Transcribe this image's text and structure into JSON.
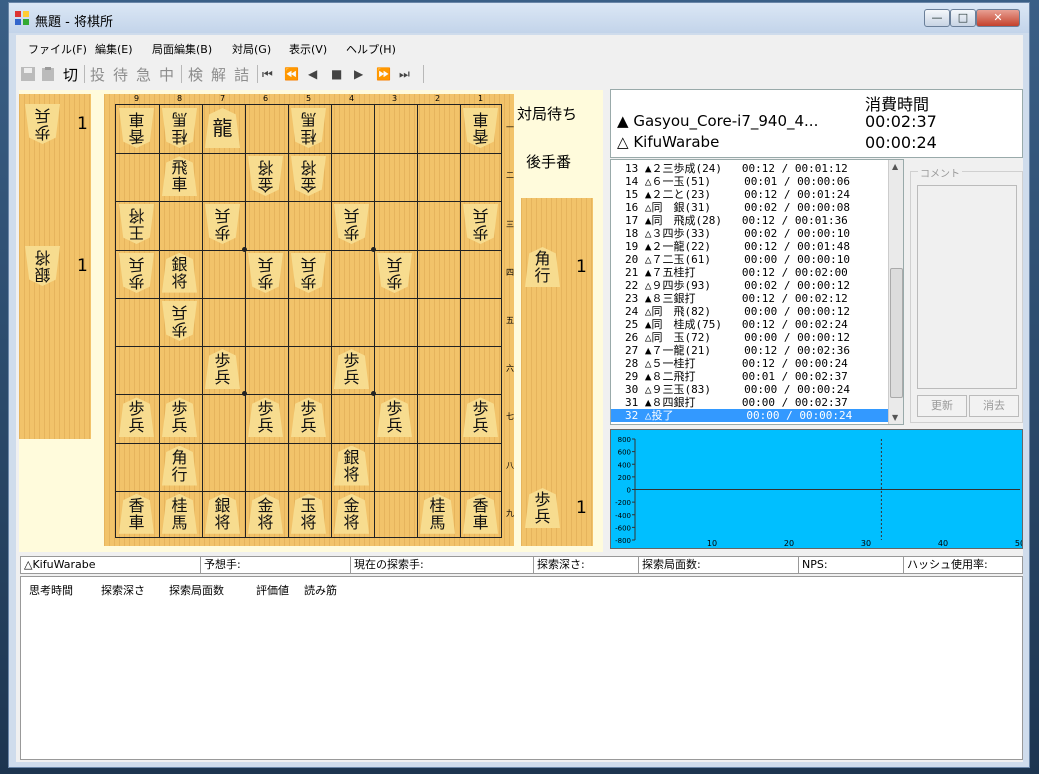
{
  "window": {
    "title": "無題 - 将棋所",
    "min": "—",
    "max": "□",
    "close": "✕"
  },
  "menu": [
    "ファイル(F)",
    "編集(E)",
    "局面編集(B)",
    "対局(G)",
    "表示(V)",
    "ヘルプ(H)"
  ],
  "toolbar": {
    "cut": "切",
    "kanji_buttons": [
      "投",
      "待",
      "急",
      "中",
      "検",
      "解",
      "詰"
    ],
    "nav_buttons": [
      "⏮",
      "⏪",
      "◀",
      "■",
      "▶",
      "⏩",
      "⏭"
    ]
  },
  "board": {
    "files": [
      "9",
      "8",
      "7",
      "6",
      "5",
      "4",
      "3",
      "2",
      "1"
    ],
    "ranks": [
      "一",
      "二",
      "三",
      "四",
      "五",
      "六",
      "七",
      "八",
      "九"
    ],
    "pieces": [
      {
        "f": 9,
        "r": 1,
        "c": [
          "香",
          "車"
        ],
        "g": true
      },
      {
        "f": 8,
        "r": 1,
        "c": [
          "桂",
          "馬"
        ],
        "g": true
      },
      {
        "f": 7,
        "r": 1,
        "c": [
          "龍"
        ],
        "g": false
      },
      {
        "f": 5,
        "r": 1,
        "c": [
          "桂",
          "馬"
        ],
        "g": true
      },
      {
        "f": 1,
        "r": 1,
        "c": [
          "香",
          "車"
        ],
        "g": true
      },
      {
        "f": 8,
        "r": 2,
        "c": [
          "飛",
          "車"
        ],
        "g": false
      },
      {
        "f": 6,
        "r": 2,
        "c": [
          "金",
          "将"
        ],
        "g": true
      },
      {
        "f": 5,
        "r": 2,
        "c": [
          "金",
          "将"
        ],
        "g": true
      },
      {
        "f": 9,
        "r": 3,
        "c": [
          "王",
          "将"
        ],
        "g": true
      },
      {
        "f": 7,
        "r": 3,
        "c": [
          "歩",
          "兵"
        ],
        "g": true
      },
      {
        "f": 4,
        "r": 3,
        "c": [
          "歩",
          "兵"
        ],
        "g": true
      },
      {
        "f": 1,
        "r": 3,
        "c": [
          "歩",
          "兵"
        ],
        "g": true
      },
      {
        "f": 9,
        "r": 4,
        "c": [
          "歩",
          "兵"
        ],
        "g": true
      },
      {
        "f": 8,
        "r": 4,
        "c": [
          "銀",
          "将"
        ],
        "g": false
      },
      {
        "f": 6,
        "r": 4,
        "c": [
          "歩",
          "兵"
        ],
        "g": true
      },
      {
        "f": 5,
        "r": 4,
        "c": [
          "歩",
          "兵"
        ],
        "g": true
      },
      {
        "f": 3,
        "r": 4,
        "c": [
          "歩",
          "兵"
        ],
        "g": true
      },
      {
        "f": 8,
        "r": 5,
        "c": [
          "歩",
          "兵"
        ],
        "g": true
      },
      {
        "f": 7,
        "r": 6,
        "c": [
          "歩",
          "兵"
        ],
        "g": false
      },
      {
        "f": 4,
        "r": 6,
        "c": [
          "歩",
          "兵"
        ],
        "g": false
      },
      {
        "f": 9,
        "r": 7,
        "c": [
          "歩",
          "兵"
        ],
        "g": false
      },
      {
        "f": 8,
        "r": 7,
        "c": [
          "歩",
          "兵"
        ],
        "g": false
      },
      {
        "f": 6,
        "r": 7,
        "c": [
          "歩",
          "兵"
        ],
        "g": false
      },
      {
        "f": 5,
        "r": 7,
        "c": [
          "歩",
          "兵"
        ],
        "g": false
      },
      {
        "f": 3,
        "r": 7,
        "c": [
          "歩",
          "兵"
        ],
        "g": false
      },
      {
        "f": 1,
        "r": 7,
        "c": [
          "歩",
          "兵"
        ],
        "g": false
      },
      {
        "f": 8,
        "r": 8,
        "c": [
          "角",
          "行"
        ],
        "g": false
      },
      {
        "f": 4,
        "r": 8,
        "c": [
          "銀",
          "将"
        ],
        "g": false
      },
      {
        "f": 9,
        "r": 9,
        "c": [
          "香",
          "車"
        ],
        "g": false
      },
      {
        "f": 8,
        "r": 9,
        "c": [
          "桂",
          "馬"
        ],
        "g": false
      },
      {
        "f": 7,
        "r": 9,
        "c": [
          "銀",
          "将"
        ],
        "g": false
      },
      {
        "f": 6,
        "r": 9,
        "c": [
          "金",
          "将"
        ],
        "g": false
      },
      {
        "f": 5,
        "r": 9,
        "c": [
          "玉",
          "将"
        ],
        "g": false
      },
      {
        "f": 4,
        "r": 9,
        "c": [
          "金",
          "将"
        ],
        "g": false
      },
      {
        "f": 2,
        "r": 9,
        "c": [
          "桂",
          "馬"
        ],
        "g": false
      },
      {
        "f": 1,
        "r": 9,
        "c": [
          "香",
          "車"
        ],
        "g": false
      }
    ]
  },
  "gote_hand": [
    {
      "c": [
        "歩",
        "兵"
      ],
      "count": "1"
    },
    {
      "c": [
        "銀",
        "将"
      ],
      "count": "1"
    }
  ],
  "sente_hand": [
    {
      "c": [
        "角",
        "行"
      ],
      "count": "1"
    },
    {
      "c": [
        "歩",
        "兵"
      ],
      "count": "1"
    }
  ],
  "status": {
    "waiting": "対局待ち",
    "turn": "後手番"
  },
  "players": {
    "header": "消費時間",
    "sente_mark": "▲",
    "sente_name": "Gasyou_Core-i7_940_4...",
    "sente_time": "00:02:37",
    "gote_mark": "△",
    "gote_name": "KifuWarabe",
    "gote_time": "00:00:24"
  },
  "moves": [
    "13 ▲２三歩成(24)   00:12 / 00:01:12",
    "14 △６一玉(51)     00:01 / 00:00:06",
    "15 ▲２二と(23)     00:12 / 00:01:24",
    "16 △同　銀(31)     00:02 / 00:00:08",
    "17 ▲同　飛成(28)   00:12 / 00:01:36",
    "18 △３四歩(33)     00:02 / 00:00:10",
    "19 ▲２一龍(22)     00:12 / 00:01:48",
    "20 △７二玉(61)     00:00 / 00:00:10",
    "21 ▲７五桂打       00:12 / 00:02:00",
    "22 △９四歩(93)     00:02 / 00:00:12",
    "23 ▲８三銀打       00:12 / 00:02:12",
    "24 △同　飛(82)     00:00 / 00:00:12",
    "25 ▲同　桂成(75)   00:12 / 00:02:24",
    "26 △同　玉(72)     00:00 / 00:00:12",
    "27 ▲７一龍(21)     00:12 / 00:02:36",
    "28 △５一桂打       00:12 / 00:00:24",
    "29 ▲８二飛打       00:01 / 00:02:37",
    "30 △９三玉(83)     00:00 / 00:00:24",
    "31 ▲８四銀打       00:00 / 00:02:37",
    "32 △投了           00:00 / 00:00:24"
  ],
  "comment": {
    "label": "コメント",
    "update": "更新",
    "clear": "消去"
  },
  "graph": {
    "bg": "#00bfff",
    "y_ticks": [
      "800",
      "600",
      "400",
      "200",
      "0",
      "-200",
      "-400",
      "-600",
      "-800"
    ],
    "x_ticks": [
      "10",
      "20",
      "30",
      "40",
      "50"
    ],
    "marker_move": 32
  },
  "engine_status": [
    "△KifuWarabe",
    "予想手:",
    "現在の探索手:",
    "探索深さ:",
    "探索局面数:",
    "NPS:",
    "ハッシュ使用率:"
  ],
  "think_headers": [
    "思考時間",
    "探索深さ",
    "探索局面数",
    "評価値",
    "読み筋"
  ]
}
